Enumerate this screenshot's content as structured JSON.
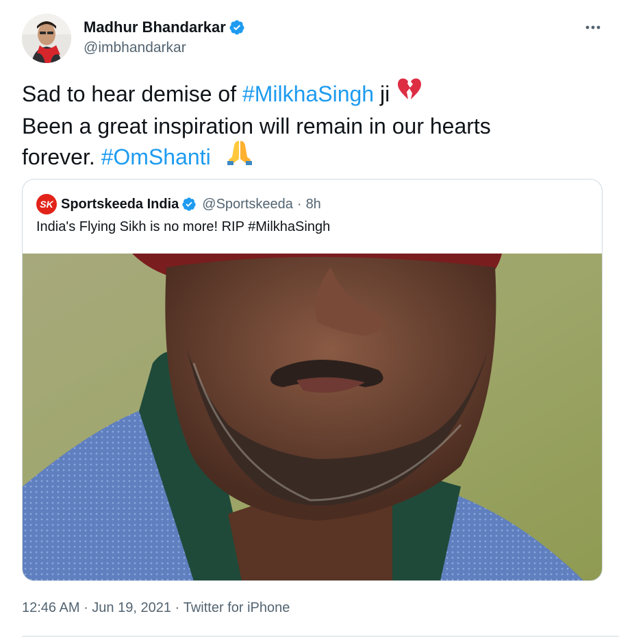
{
  "author": {
    "display_name": "Madhur Bhandarkar",
    "handle": "@imbhandarkar",
    "verified": true
  },
  "tweet": {
    "line1_prefix": "Sad to hear demise of ",
    "hashtag1": "#MilkhaSingh",
    "line1_suffix": " ji",
    "emoji1": "broken-heart-icon",
    "line2": "Been a great inspiration will remain in our hearts",
    "line3_prefix": "forever. ",
    "hashtag2": "#OmShanti",
    "emoji2": "folded-hands-icon"
  },
  "quoted_tweet": {
    "logo_text": "SK",
    "display_name": "Sportskeeda India",
    "handle": "@Sportskeeda",
    "separator": "·",
    "time": "8h",
    "text": "India's Flying Sikh is no more! RIP #MilkhaSingh",
    "media": "photo-of-man-with-grey-beard-red-turban-blue-shirt"
  },
  "footer": {
    "time": "12:46 AM",
    "separator": " · ",
    "date": "Jun 19, 2021",
    "source": "Twitter for iPhone"
  },
  "colors": {
    "link": "#1d9bf0",
    "secondary_text": "#536471",
    "verified": "#1d9bf0",
    "brand_sportskeeda": "#e2231a",
    "border": "#cfd9de"
  }
}
